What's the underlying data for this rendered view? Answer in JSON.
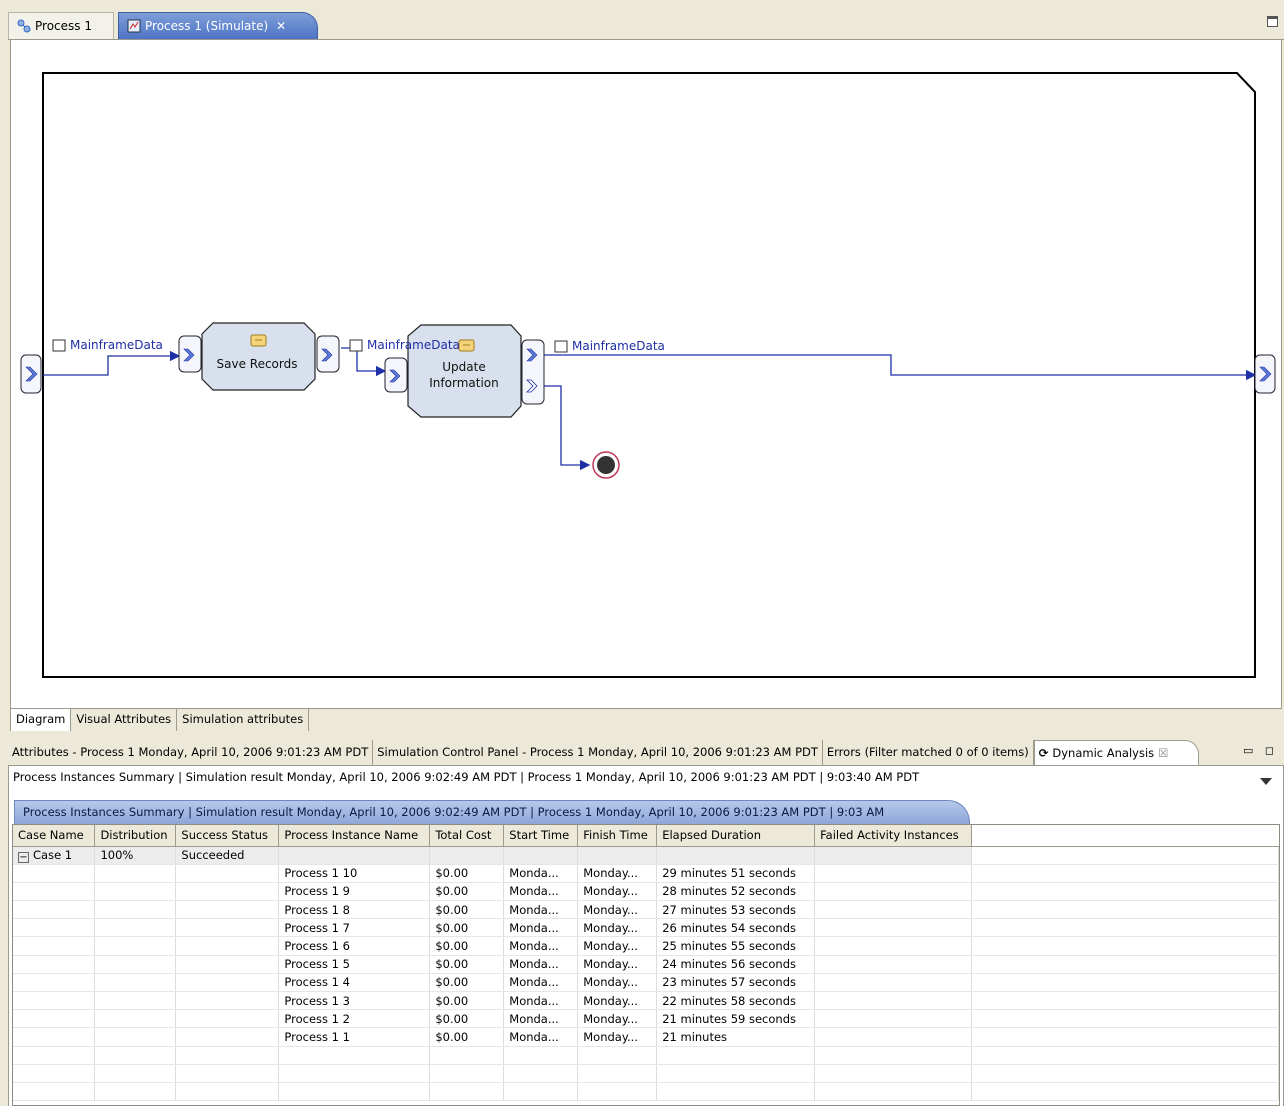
{
  "editor_tabs": [
    {
      "label": "Process 1",
      "active": false
    },
    {
      "label": "Process 1 (Simulate)",
      "active": true,
      "close": "✕"
    }
  ],
  "diagram": {
    "tasks": [
      {
        "label_lines": [
          "Save Records"
        ]
      },
      {
        "label_lines": [
          "Update",
          "Information"
        ]
      }
    ],
    "data_labels": [
      "MainframeData",
      "MainframeData",
      "MainframeData"
    ]
  },
  "editor_bottom_tabs": [
    "Diagram",
    "Visual Attributes",
    "Simulation attributes"
  ],
  "views_tabs": [
    "Attributes - Process 1 Monday, April 10, 2006 9:01:23 AM PDT",
    "Simulation Control Panel - Process 1 Monday, April 10, 2006 9:01:23 AM PDT",
    "Errors (Filter matched 0 of 0 items)",
    "Dynamic Analysis"
  ],
  "active_view_close": "☒",
  "view_controls": "▭ ◻",
  "summary_line": "Process Instances Summary | Simulation result Monday, April 10, 2006 9:02:49 AM PDT | Process 1 Monday, April 10, 2006 9:01:23 AM PDT | 9:03:40 AM PDT",
  "result_tab": "Process Instances Summary | Simulation result Monday, April 10, 2006 9:02:49 AM PDT | Process 1 Monday, April 10, 2006 9:01:23 AM PDT | 9:03 AM",
  "table": {
    "columns": [
      "Case Name",
      "Distribution",
      "Success Status",
      "Process Instance Name",
      "Total Cost",
      "Start Time",
      "Finish Time",
      "Elapsed Duration",
      "Failed Activity Instances"
    ],
    "case_row": {
      "toggle": "−",
      "case_name": "Case 1",
      "distribution": "100%",
      "status": "Succeeded"
    },
    "rows": [
      {
        "name": "Process 1  10",
        "cost": "$0.00",
        "start": "Monda...",
        "finish": "Monday...",
        "elapsed": "29 minutes 51 seconds"
      },
      {
        "name": "Process 1  9",
        "cost": "$0.00",
        "start": "Monda...",
        "finish": "Monday...",
        "elapsed": "28 minutes 52 seconds"
      },
      {
        "name": "Process 1  8",
        "cost": "$0.00",
        "start": "Monda...",
        "finish": "Monday...",
        "elapsed": "27 minutes 53 seconds"
      },
      {
        "name": "Process 1  7",
        "cost": "$0.00",
        "start": "Monda...",
        "finish": "Monday...",
        "elapsed": "26 minutes 54 seconds"
      },
      {
        "name": "Process 1  6",
        "cost": "$0.00",
        "start": "Monda...",
        "finish": "Monday...",
        "elapsed": "25 minutes 55 seconds"
      },
      {
        "name": "Process 1  5",
        "cost": "$0.00",
        "start": "Monda...",
        "finish": "Monday...",
        "elapsed": "24 minutes 56 seconds"
      },
      {
        "name": "Process 1  4",
        "cost": "$0.00",
        "start": "Monda...",
        "finish": "Monday...",
        "elapsed": "23 minutes 57 seconds"
      },
      {
        "name": "Process 1  3",
        "cost": "$0.00",
        "start": "Monda...",
        "finish": "Monday...",
        "elapsed": "22 minutes 58 seconds"
      },
      {
        "name": "Process 1  2",
        "cost": "$0.00",
        "start": "Monda...",
        "finish": "Monday...",
        "elapsed": "21 minutes 59 seconds"
      },
      {
        "name": "Process 1  1",
        "cost": "$0.00",
        "start": "Monda...",
        "finish": "Monday...",
        "elapsed": "21 minutes"
      }
    ]
  },
  "colors": {
    "connector": "#1f2fa6",
    "task_fill": "#d7e0ec",
    "active_tab": "#4d73c4"
  }
}
